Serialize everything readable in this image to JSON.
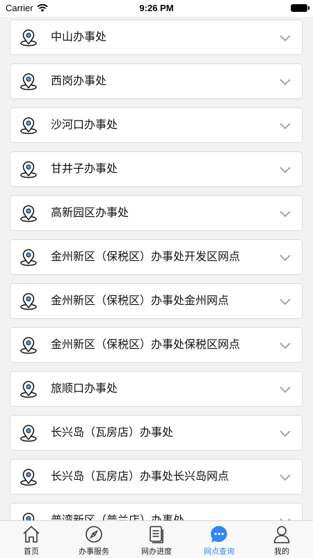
{
  "status_bar": {
    "carrier": "Carrier",
    "time": "9:26 PM"
  },
  "offices": [
    "中山办事处",
    "西岗办事处",
    "沙河口办事处",
    "甘井子办事处",
    "高新园区办事处",
    "金州新区（保税区）办事处开发区网点",
    "金州新区（保税区）办事处金州网点",
    "金州新区（保税区）办事处保税区网点",
    "旅顺口办事处",
    "长兴岛（瓦房店）办事处",
    "长兴岛（瓦房店）办事处长兴岛网点",
    "普湾新区（普兰店）办事处"
  ],
  "tabs": [
    {
      "label": "首页",
      "icon": "home-icon"
    },
    {
      "label": "办事服务",
      "icon": "compass-icon"
    },
    {
      "label": "网办进度",
      "icon": "document-icon"
    },
    {
      "label": "网点查询",
      "icon": "chat-bubble-icon",
      "active": true
    },
    {
      "label": "我的",
      "icon": "user-icon"
    }
  ],
  "colors": {
    "accent": "#2f86f6",
    "pin_outline": "#111111",
    "pin_fill": "#5b9bd5"
  }
}
